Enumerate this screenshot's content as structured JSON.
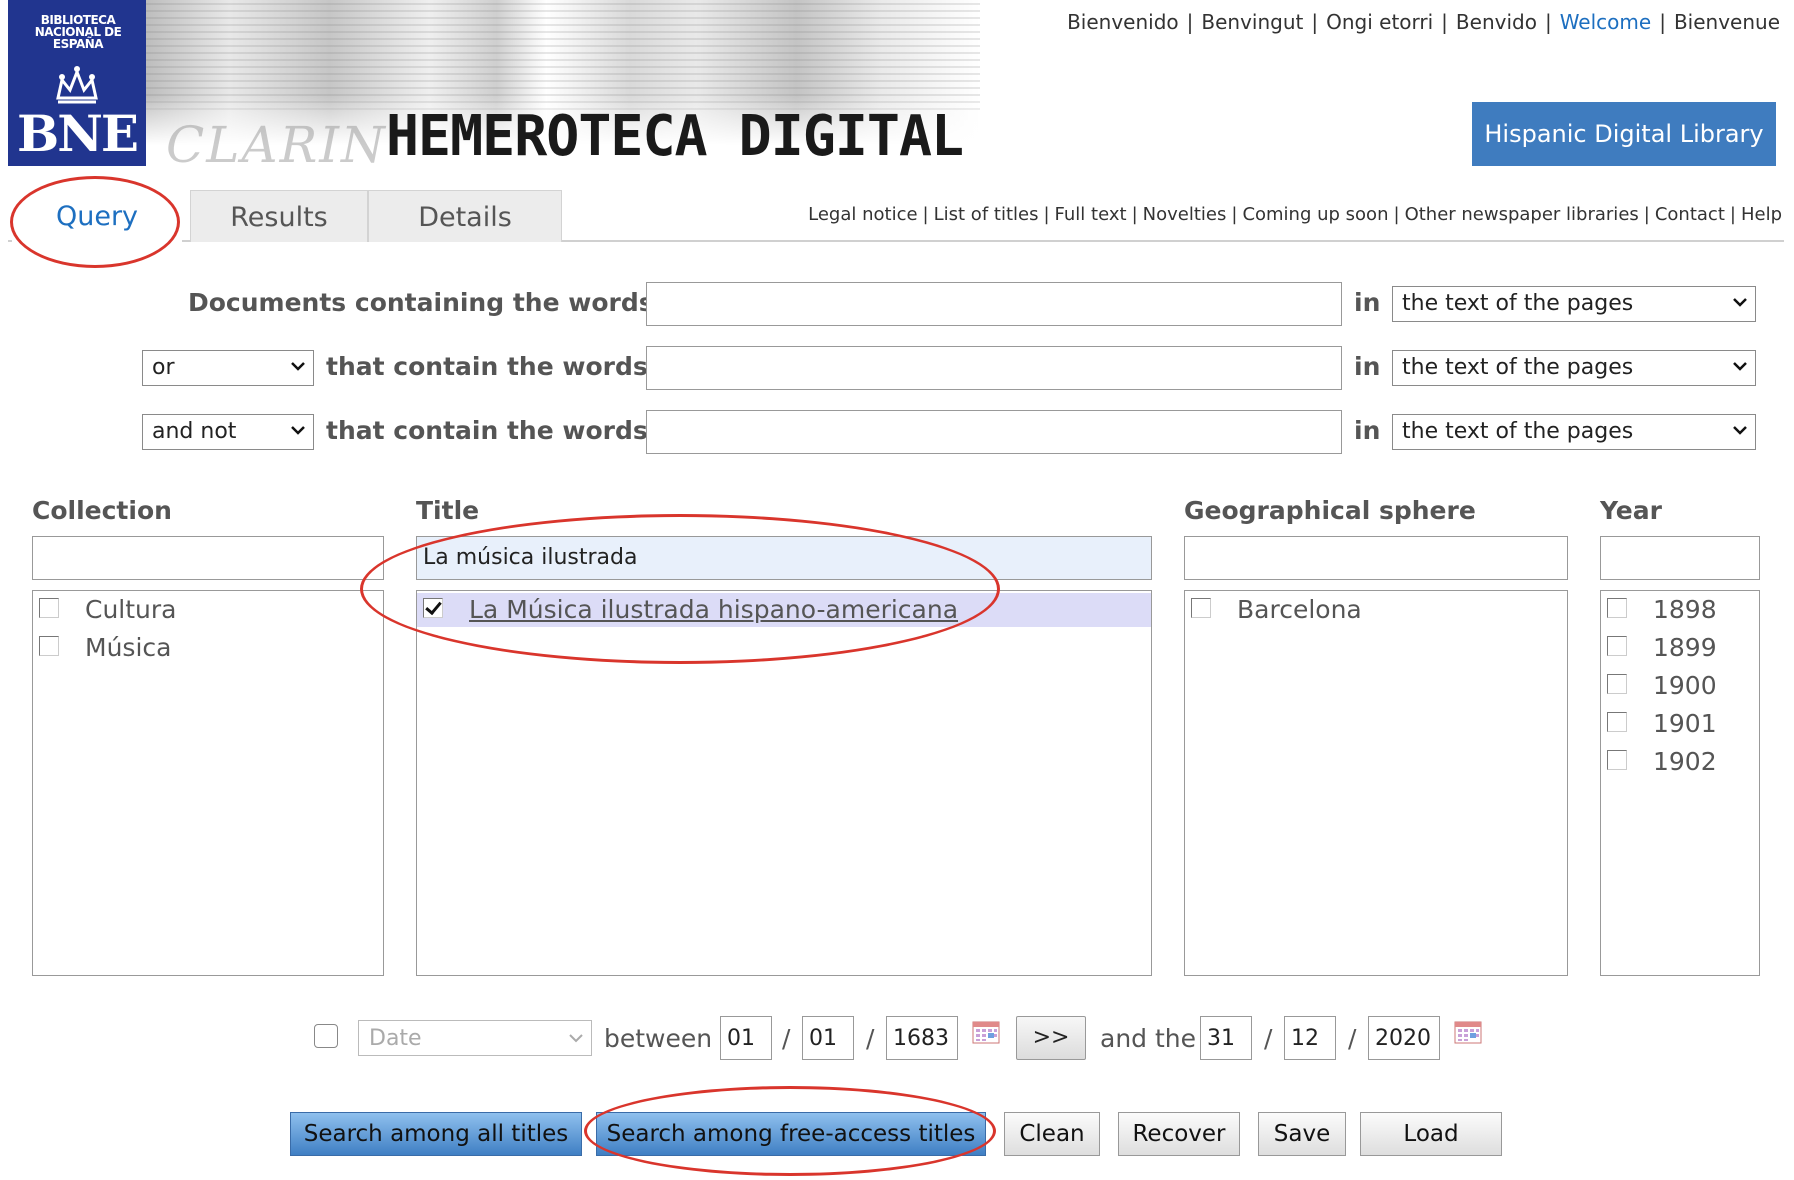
{
  "header": {
    "logo_small": "BIBLIOTECA NACIONAL DE ESPAÑA",
    "logo_big": "BNE",
    "banner_title": "HEMEROTECA DIGITAL",
    "banner_ghost": "CLARIN",
    "languages": [
      "Bienvenido",
      "Benvingut",
      "Ongi etorri",
      "Benvido",
      "Welcome",
      "Bienvenue"
    ],
    "active_language": "Welcome",
    "hispanic_library": "Hispanic Digital Library"
  },
  "tabs": [
    {
      "label": "Query",
      "active": true
    },
    {
      "label": "Results",
      "active": false
    },
    {
      "label": "Details",
      "active": false
    }
  ],
  "top_links": [
    "Legal notice",
    "List of titles",
    "Full text",
    "Novelties",
    "Coming up soon",
    "Other newspaper libraries",
    "Contact",
    "Help"
  ],
  "query": {
    "row1_label": "Documents containing the words",
    "row_label": "that contain the words",
    "in_label": "in",
    "operator2": "or",
    "operator3": "and not",
    "scope1": "the text of the pages",
    "scope2": "the text of the pages",
    "scope3": "the text of the pages",
    "words1": "",
    "words2": "",
    "words3": ""
  },
  "facets": {
    "collection": {
      "heading": "Collection",
      "filter": "",
      "items": [
        "Cultura",
        "Música"
      ]
    },
    "title": {
      "heading": "Title",
      "filter": "La música ilustrada",
      "items": [
        {
          "label": "La Música ilustrada hispano-americana",
          "checked": true
        }
      ]
    },
    "geo": {
      "heading": "Geographical sphere",
      "filter": "",
      "items": [
        "Barcelona"
      ]
    },
    "year": {
      "heading": "Year",
      "filter": "",
      "items": [
        "1898",
        "1899",
        "1900",
        "1901",
        "1902"
      ]
    }
  },
  "date_filter": {
    "type_placeholder": "Date",
    "between": "between",
    "and_the": "and the",
    "from_day": "01",
    "from_month": "01",
    "from_year": "1683",
    "to_day": "31",
    "to_month": "12",
    "to_year": "2020",
    "slash": "/",
    "copy_button": ">>"
  },
  "buttons": {
    "search_all": "Search among all titles",
    "search_free": "Search among free-access titles",
    "clean": "Clean",
    "recover": "Recover",
    "save": "Save",
    "load": "Load"
  },
  "colors": {
    "bne_blue": "#21358f",
    "link_blue": "#1d6fc0",
    "button_blue": "#3f7cbf",
    "annotation_red": "#d9352c",
    "selected_row": "#dcdcf7"
  }
}
